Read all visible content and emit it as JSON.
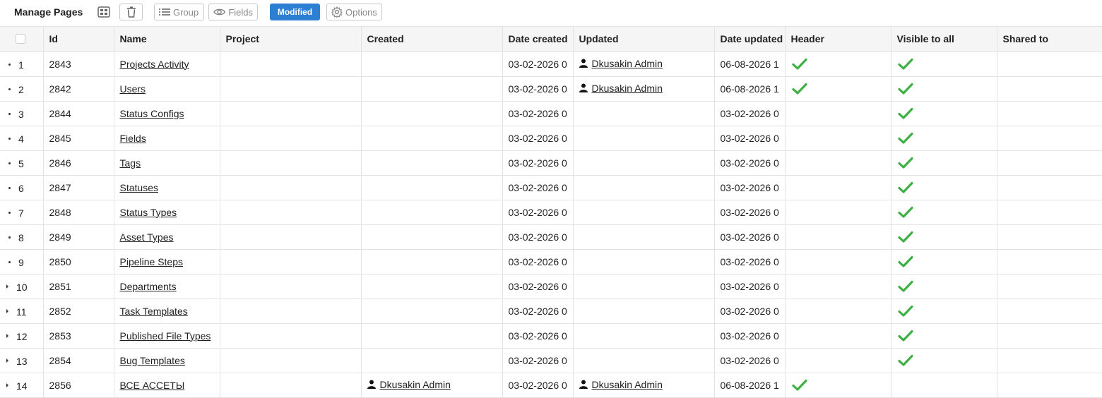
{
  "toolbar": {
    "title": "Manage Pages",
    "group_label": "Group",
    "fields_label": "Fields",
    "modified_label": "Modified",
    "options_label": "Options"
  },
  "columns": [
    "Id",
    "Name",
    "Project",
    "Created",
    "Date created",
    "Updated",
    "Date updated",
    "Header",
    "Visible to all",
    "Shared to"
  ],
  "rows": [
    {
      "num": "1",
      "id": "2843",
      "name": "Projects Activity",
      "project": "",
      "created": "",
      "date_created": "03-02-2026 0",
      "updated": "Dkusakin Admin",
      "date_updated": "06-08-2026 1",
      "header": true,
      "visible": true,
      "shared": ""
    },
    {
      "num": "2",
      "id": "2842",
      "name": "Users",
      "project": "",
      "created": "",
      "date_created": "03-02-2026 0",
      "updated": "Dkusakin Admin",
      "date_updated": "06-08-2026 1",
      "header": true,
      "visible": true,
      "shared": ""
    },
    {
      "num": "3",
      "id": "2844",
      "name": "Status Configs",
      "project": "",
      "created": "",
      "date_created": "03-02-2026 0",
      "updated": "",
      "date_updated": "03-02-2026 0",
      "header": false,
      "visible": true,
      "shared": ""
    },
    {
      "num": "4",
      "id": "2845",
      "name": "Fields",
      "project": "",
      "created": "",
      "date_created": "03-02-2026 0",
      "updated": "",
      "date_updated": "03-02-2026 0",
      "header": false,
      "visible": true,
      "shared": ""
    },
    {
      "num": "5",
      "id": "2846",
      "name": "Tags",
      "project": "",
      "created": "",
      "date_created": "03-02-2026 0",
      "updated": "",
      "date_updated": "03-02-2026 0",
      "header": false,
      "visible": true,
      "shared": ""
    },
    {
      "num": "6",
      "id": "2847",
      "name": "Statuses",
      "project": "",
      "created": "",
      "date_created": "03-02-2026 0",
      "updated": "",
      "date_updated": "03-02-2026 0",
      "header": false,
      "visible": true,
      "shared": ""
    },
    {
      "num": "7",
      "id": "2848",
      "name": "Status Types",
      "project": "",
      "created": "",
      "date_created": "03-02-2026 0",
      "updated": "",
      "date_updated": "03-02-2026 0",
      "header": false,
      "visible": true,
      "shared": ""
    },
    {
      "num": "8",
      "id": "2849",
      "name": "Asset Types",
      "project": "",
      "created": "",
      "date_created": "03-02-2026 0",
      "updated": "",
      "date_updated": "03-02-2026 0",
      "header": false,
      "visible": true,
      "shared": ""
    },
    {
      "num": "9",
      "id": "2850",
      "name": "Pipeline Steps",
      "project": "",
      "created": "",
      "date_created": "03-02-2026 0",
      "updated": "",
      "date_updated": "03-02-2026 0",
      "header": false,
      "visible": true,
      "shared": ""
    },
    {
      "num": "10",
      "id": "2851",
      "name": "Departments",
      "project": "",
      "created": "",
      "date_created": "03-02-2026 0",
      "updated": "",
      "date_updated": "03-02-2026 0",
      "header": false,
      "visible": true,
      "shared": ""
    },
    {
      "num": "11",
      "id": "2852",
      "name": "Task Templates",
      "project": "",
      "created": "",
      "date_created": "03-02-2026 0",
      "updated": "",
      "date_updated": "03-02-2026 0",
      "header": false,
      "visible": true,
      "shared": ""
    },
    {
      "num": "12",
      "id": "2853",
      "name": "Published File Types",
      "project": "",
      "created": "",
      "date_created": "03-02-2026 0",
      "updated": "",
      "date_updated": "03-02-2026 0",
      "header": false,
      "visible": true,
      "shared": ""
    },
    {
      "num": "13",
      "id": "2854",
      "name": "Bug Templates",
      "project": "",
      "created": "",
      "date_created": "03-02-2026 0",
      "updated": "",
      "date_updated": "03-02-2026 0",
      "header": false,
      "visible": true,
      "shared": ""
    },
    {
      "num": "14",
      "id": "2856",
      "name": "ВСЕ АССЕТЫ",
      "project": "",
      "created": "Dkusakin Admin",
      "date_created": "03-02-2026 0",
      "updated": "Dkusakin Admin",
      "date_updated": "06-08-2026 1",
      "header": true,
      "visible": false,
      "shared": ""
    }
  ],
  "colors": {
    "accent": "#2d7fd3",
    "check": "#3cb043",
    "header_bg": "#f5f5f5",
    "border": "#e3e3e3"
  },
  "icons": [
    "layout-icon",
    "trash-icon",
    "list-icon",
    "eye-icon",
    "gear-icon",
    "user-icon",
    "check-icon"
  ]
}
